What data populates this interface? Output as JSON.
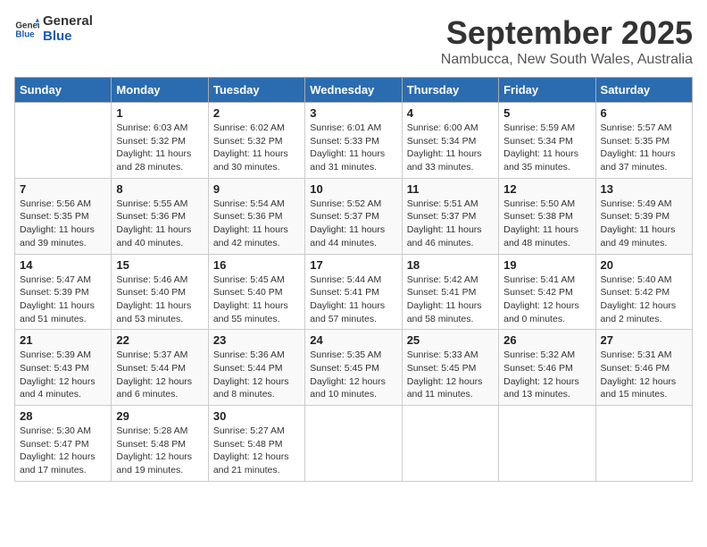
{
  "logo": {
    "text_general": "General",
    "text_blue": "Blue"
  },
  "header": {
    "month": "September 2025",
    "location": "Nambucca, New South Wales, Australia"
  },
  "days_of_week": [
    "Sunday",
    "Monday",
    "Tuesday",
    "Wednesday",
    "Thursday",
    "Friday",
    "Saturday"
  ],
  "weeks": [
    [
      {
        "day": "",
        "info": ""
      },
      {
        "day": "1",
        "info": "Sunrise: 6:03 AM\nSunset: 5:32 PM\nDaylight: 11 hours\nand 28 minutes."
      },
      {
        "day": "2",
        "info": "Sunrise: 6:02 AM\nSunset: 5:32 PM\nDaylight: 11 hours\nand 30 minutes."
      },
      {
        "day": "3",
        "info": "Sunrise: 6:01 AM\nSunset: 5:33 PM\nDaylight: 11 hours\nand 31 minutes."
      },
      {
        "day": "4",
        "info": "Sunrise: 6:00 AM\nSunset: 5:34 PM\nDaylight: 11 hours\nand 33 minutes."
      },
      {
        "day": "5",
        "info": "Sunrise: 5:59 AM\nSunset: 5:34 PM\nDaylight: 11 hours\nand 35 minutes."
      },
      {
        "day": "6",
        "info": "Sunrise: 5:57 AM\nSunset: 5:35 PM\nDaylight: 11 hours\nand 37 minutes."
      }
    ],
    [
      {
        "day": "7",
        "info": "Sunrise: 5:56 AM\nSunset: 5:35 PM\nDaylight: 11 hours\nand 39 minutes."
      },
      {
        "day": "8",
        "info": "Sunrise: 5:55 AM\nSunset: 5:36 PM\nDaylight: 11 hours\nand 40 minutes."
      },
      {
        "day": "9",
        "info": "Sunrise: 5:54 AM\nSunset: 5:36 PM\nDaylight: 11 hours\nand 42 minutes."
      },
      {
        "day": "10",
        "info": "Sunrise: 5:52 AM\nSunset: 5:37 PM\nDaylight: 11 hours\nand 44 minutes."
      },
      {
        "day": "11",
        "info": "Sunrise: 5:51 AM\nSunset: 5:37 PM\nDaylight: 11 hours\nand 46 minutes."
      },
      {
        "day": "12",
        "info": "Sunrise: 5:50 AM\nSunset: 5:38 PM\nDaylight: 11 hours\nand 48 minutes."
      },
      {
        "day": "13",
        "info": "Sunrise: 5:49 AM\nSunset: 5:39 PM\nDaylight: 11 hours\nand 49 minutes."
      }
    ],
    [
      {
        "day": "14",
        "info": "Sunrise: 5:47 AM\nSunset: 5:39 PM\nDaylight: 11 hours\nand 51 minutes."
      },
      {
        "day": "15",
        "info": "Sunrise: 5:46 AM\nSunset: 5:40 PM\nDaylight: 11 hours\nand 53 minutes."
      },
      {
        "day": "16",
        "info": "Sunrise: 5:45 AM\nSunset: 5:40 PM\nDaylight: 11 hours\nand 55 minutes."
      },
      {
        "day": "17",
        "info": "Sunrise: 5:44 AM\nSunset: 5:41 PM\nDaylight: 11 hours\nand 57 minutes."
      },
      {
        "day": "18",
        "info": "Sunrise: 5:42 AM\nSunset: 5:41 PM\nDaylight: 11 hours\nand 58 minutes."
      },
      {
        "day": "19",
        "info": "Sunrise: 5:41 AM\nSunset: 5:42 PM\nDaylight: 12 hours\nand 0 minutes."
      },
      {
        "day": "20",
        "info": "Sunrise: 5:40 AM\nSunset: 5:42 PM\nDaylight: 12 hours\nand 2 minutes."
      }
    ],
    [
      {
        "day": "21",
        "info": "Sunrise: 5:39 AM\nSunset: 5:43 PM\nDaylight: 12 hours\nand 4 minutes."
      },
      {
        "day": "22",
        "info": "Sunrise: 5:37 AM\nSunset: 5:44 PM\nDaylight: 12 hours\nand 6 minutes."
      },
      {
        "day": "23",
        "info": "Sunrise: 5:36 AM\nSunset: 5:44 PM\nDaylight: 12 hours\nand 8 minutes."
      },
      {
        "day": "24",
        "info": "Sunrise: 5:35 AM\nSunset: 5:45 PM\nDaylight: 12 hours\nand 10 minutes."
      },
      {
        "day": "25",
        "info": "Sunrise: 5:33 AM\nSunset: 5:45 PM\nDaylight: 12 hours\nand 11 minutes."
      },
      {
        "day": "26",
        "info": "Sunrise: 5:32 AM\nSunset: 5:46 PM\nDaylight: 12 hours\nand 13 minutes."
      },
      {
        "day": "27",
        "info": "Sunrise: 5:31 AM\nSunset: 5:46 PM\nDaylight: 12 hours\nand 15 minutes."
      }
    ],
    [
      {
        "day": "28",
        "info": "Sunrise: 5:30 AM\nSunset: 5:47 PM\nDaylight: 12 hours\nand 17 minutes."
      },
      {
        "day": "29",
        "info": "Sunrise: 5:28 AM\nSunset: 5:48 PM\nDaylight: 12 hours\nand 19 minutes."
      },
      {
        "day": "30",
        "info": "Sunrise: 5:27 AM\nSunset: 5:48 PM\nDaylight: 12 hours\nand 21 minutes."
      },
      {
        "day": "",
        "info": ""
      },
      {
        "day": "",
        "info": ""
      },
      {
        "day": "",
        "info": ""
      },
      {
        "day": "",
        "info": ""
      }
    ]
  ]
}
